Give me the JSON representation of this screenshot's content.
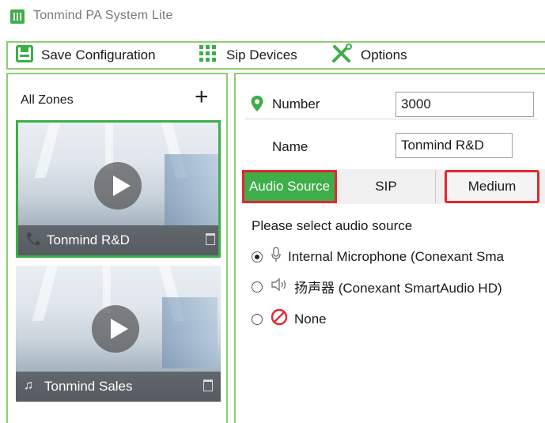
{
  "app": {
    "title": "Tonmind PA System Lite",
    "accent": "#3fae49",
    "highlight": "#e0292e"
  },
  "toolbar": {
    "save_label": "Save Configuration",
    "sip_label": "Sip Devices",
    "options_label": "Options"
  },
  "zones": {
    "title": "All Zones",
    "add_icon": "plus-icon",
    "items": [
      {
        "name": "Tonmind R&D",
        "icon": "phone-icon",
        "selected": true
      },
      {
        "name": "Tonmind Sales",
        "icon": "music-note-icon",
        "selected": false
      }
    ]
  },
  "detail": {
    "number_label": "Number",
    "number_value": "3000",
    "name_label": "Name",
    "name_value": "Tonmind R&D",
    "tabs": [
      {
        "label": "Audio Source",
        "active": true
      },
      {
        "label": "SIP",
        "active": false
      },
      {
        "label": "Medium",
        "active": false
      }
    ],
    "audio": {
      "prompt": "Please select audio source",
      "options": [
        {
          "label": "Internal Microphone (Conexant Sma",
          "icon": "microphone-icon",
          "checked": true
        },
        {
          "label": "扬声器 (Conexant SmartAudio HD)",
          "icon": "speaker-icon",
          "checked": false
        },
        {
          "label": "None",
          "icon": "none-icon",
          "checked": false
        }
      ]
    }
  }
}
